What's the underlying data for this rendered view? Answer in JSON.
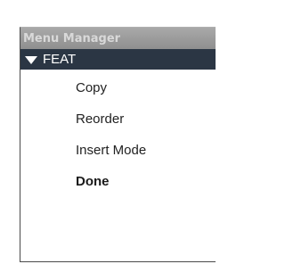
{
  "panel": {
    "title": "Menu Manager"
  },
  "group": {
    "label": "FEAT",
    "icon": "triangle-down-icon"
  },
  "menu": {
    "items": [
      {
        "label": "Copy"
      },
      {
        "label": "Reorder"
      },
      {
        "label": "Insert Mode"
      },
      {
        "label": "Done"
      }
    ]
  },
  "colors": {
    "titlebar": "#999999",
    "group_header": "#2b3644",
    "group_text": "#ffffff"
  }
}
